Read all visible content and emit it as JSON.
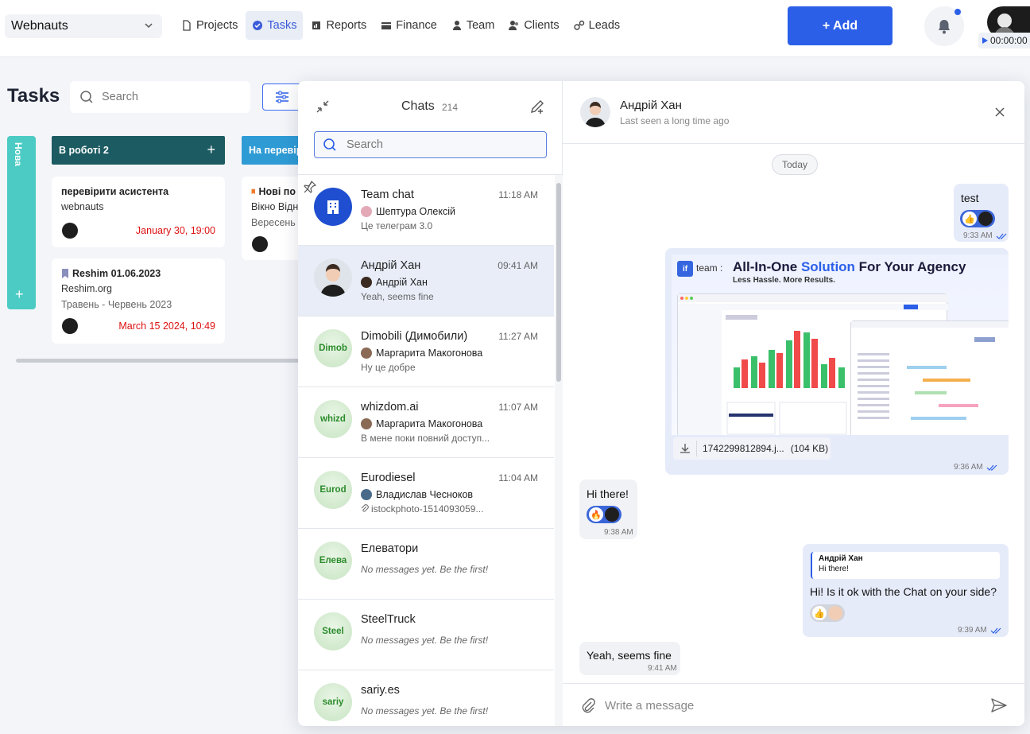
{
  "topbar": {
    "workspace": "Webnauts",
    "nav": [
      {
        "label": "Projects",
        "icon": "file-icon"
      },
      {
        "label": "Tasks",
        "icon": "check-circle-icon",
        "active": true
      },
      {
        "label": "Reports",
        "icon": "report-icon"
      },
      {
        "label": "Finance",
        "icon": "card-icon"
      },
      {
        "label": "Team",
        "icon": "person-icon"
      },
      {
        "label": "Clients",
        "icon": "clients-icon"
      },
      {
        "label": "Leads",
        "icon": "leads-icon"
      }
    ],
    "add_label": "+ Add",
    "timer": "00:00:00"
  },
  "board": {
    "title": "Tasks",
    "search_placeholder": "Search",
    "columns": {
      "nova": "Нова",
      "work": {
        "title": "В роботі",
        "count": "2"
      },
      "review": {
        "title": "На перевір"
      }
    },
    "cards": [
      {
        "title": "перевірити асистента",
        "sub": "webnauts",
        "due": "January 30, 19:00"
      },
      {
        "title": "Reshim 01.06.2023",
        "sub": "Reshim.org",
        "dates": "Травень - Червень 2023",
        "due": "March 15 2024, 10:49"
      },
      {
        "title": "Нові по",
        "sub": "Вікно Відн",
        "dates": "Вересень"
      }
    ]
  },
  "chats": {
    "title": "Chats",
    "count": "214",
    "search_placeholder": "Search",
    "items": [
      {
        "name": "Team chat",
        "time": "11:18 AM",
        "author": "Шептура Олексій",
        "preview": "Це телеграм 3.0",
        "avatar": ""
      },
      {
        "name": "Андрій Хан",
        "time": "09:41 AM",
        "author": "Андрій Хан",
        "preview": "Yeah, seems fine",
        "avatar": ""
      },
      {
        "name": "Dimobili (Димобили)",
        "time": "11:27 AM",
        "author": "Маргарита Макогонова",
        "preview": "Ну це добре",
        "avatar": "Dimob"
      },
      {
        "name": "whizdom.ai",
        "time": "11:07 AM",
        "author": "Маргарита Макогонова",
        "preview": "В мене поки повний доступ...",
        "avatar": "whizd"
      },
      {
        "name": "Eurodiesel",
        "time": "11:04 AM",
        "author": "Владислав Чесноков",
        "preview": "istockphoto-1514093059...",
        "avatar": "Eurod"
      },
      {
        "name": "Елеватори",
        "time": "",
        "author": "",
        "preview": "No messages yet. Be the first!",
        "avatar": "Елева"
      },
      {
        "name": "SteelTruck",
        "time": "",
        "author": "",
        "preview": "No messages yet. Be the first!",
        "avatar": "Steel"
      },
      {
        "name": "sariy.es",
        "time": "",
        "author": "",
        "preview": "No messages yet. Be the first!",
        "avatar": "sariy"
      }
    ]
  },
  "conversation": {
    "name": "Андрій Хан",
    "status": "Last seen a long time ago",
    "day": "Today",
    "messages": {
      "m1": {
        "text": "test",
        "time": "9:33 AM"
      },
      "m2": {
        "brand": "team :",
        "logo": "if",
        "headline_a": "All-In-One ",
        "headline_b": "Solution",
        "headline_c": " For Your Agency",
        "sub": "Less Hassle. More Results.",
        "file_name": "1742299812894.j...",
        "file_size": "(104 KB)",
        "time": "9:36 AM"
      },
      "m3": {
        "text": "Hi there!",
        "time": "9:38 AM"
      },
      "m4": {
        "reply_name": "Андрій Хан",
        "reply_text": "Hi there!",
        "text": "Hi! Is it ok with the Chat on your side?",
        "time": "9:39 AM"
      },
      "m5": {
        "text": "Yeah, seems fine",
        "time": "9:41 AM"
      }
    },
    "composer_placeholder": "Write a message"
  }
}
